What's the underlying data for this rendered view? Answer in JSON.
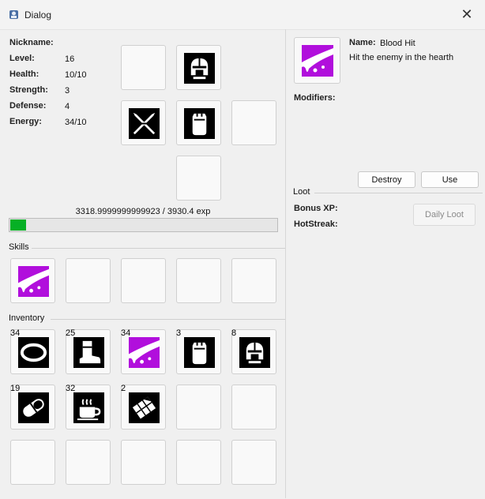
{
  "window": {
    "title": "Dialog",
    "close_glyph": "✕",
    "app_icon": "app-icon"
  },
  "stats": {
    "nickname_label": "Nickname:",
    "nickname_value": "",
    "level_label": "Level:",
    "level_value": "16",
    "health_label": "Health:",
    "health_value": "10/10",
    "strength_label": "Strength:",
    "strength_value": "3",
    "defense_label": "Defense:",
    "defense_value": "4",
    "energy_label": "Energy:",
    "energy_value": "34/10"
  },
  "equipment": [
    {
      "slot": "empty",
      "icon": ""
    },
    {
      "slot": "helmet",
      "icon": "helmet-icon"
    },
    {
      "slot": "weapon",
      "icon": "crossed-swords-icon"
    },
    {
      "slot": "armor",
      "icon": "armor-icon"
    },
    {
      "slot": "empty",
      "icon": ""
    },
    {
      "slot": "empty",
      "icon": ""
    }
  ],
  "experience": {
    "text": "3318.9999999999923 / 3930.4 exp",
    "progress_fraction": 0.06
  },
  "skills": {
    "label": "Skills",
    "slots": [
      {
        "icon": "blood-hit-icon"
      },
      {
        "icon": ""
      },
      {
        "icon": ""
      },
      {
        "icon": ""
      },
      {
        "icon": ""
      }
    ]
  },
  "inventory": {
    "label": "Inventory",
    "slots": [
      {
        "icon": "ring-icon",
        "count": "34"
      },
      {
        "icon": "boot-icon",
        "count": "25"
      },
      {
        "icon": "blood-hit-icon",
        "count": "34"
      },
      {
        "icon": "armor-icon",
        "count": "3"
      },
      {
        "icon": "helmet-icon",
        "count": "8"
      },
      {
        "icon": "pill-icon",
        "count": "19"
      },
      {
        "icon": "coffee-cup-icon",
        "count": "32"
      },
      {
        "icon": "chocolate-bar-icon",
        "count": "2"
      },
      {
        "icon": "",
        "count": ""
      },
      {
        "icon": "",
        "count": ""
      },
      {
        "icon": "",
        "count": ""
      },
      {
        "icon": "",
        "count": ""
      },
      {
        "icon": "",
        "count": ""
      },
      {
        "icon": "",
        "count": ""
      },
      {
        "icon": "",
        "count": ""
      }
    ]
  },
  "selected_item": {
    "icon": "blood-hit-icon",
    "name_label": "Name:",
    "name_value": "Blood Hit",
    "description": "Hit the enemy in the hearth",
    "modifiers_label": "Modifiers:",
    "destroy_label": "Destroy",
    "use_label": "Use"
  },
  "loot": {
    "label": "Loot",
    "bonus_xp_label": "Bonus XP:",
    "hotstreak_label": "HotStreak:",
    "daily_loot_label": "Daily Loot"
  },
  "colors": {
    "accent_purple": "#b10fdc",
    "progress_green": "#06b025",
    "tile_black": "#000000"
  }
}
